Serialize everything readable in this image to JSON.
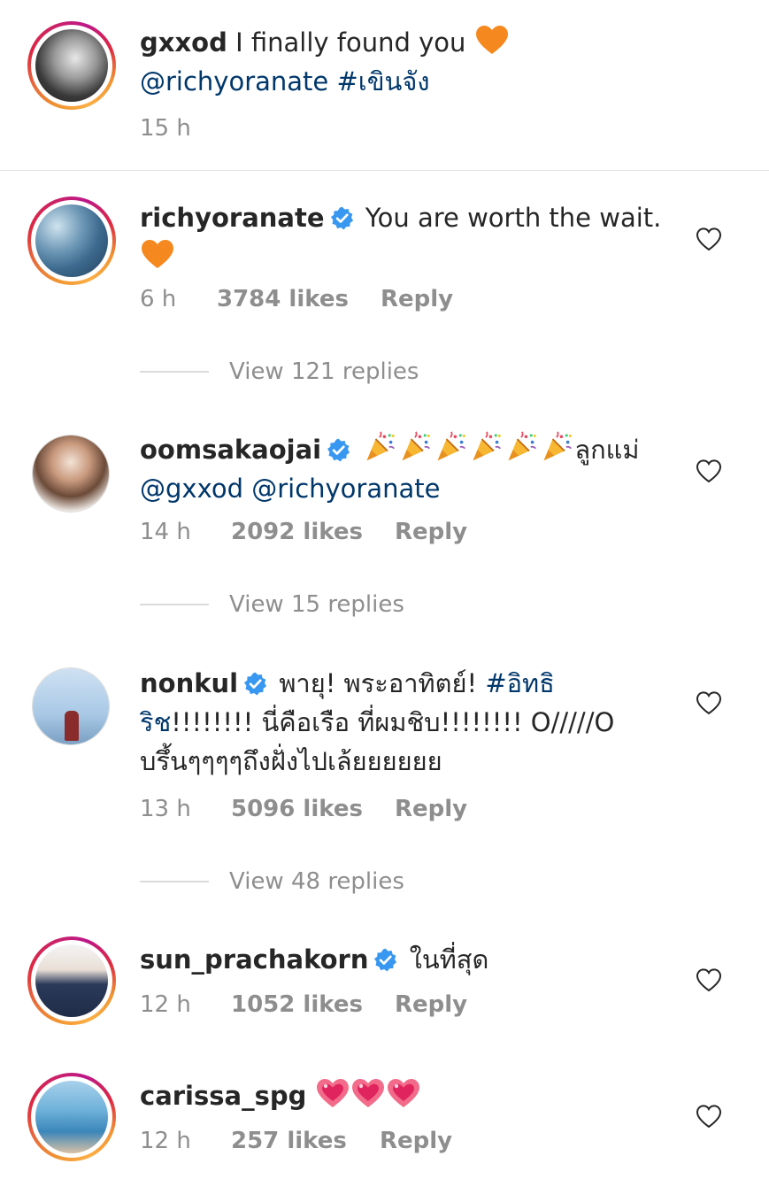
{
  "caption": {
    "username": "gxxod",
    "text": "I finally found you",
    "mention": "@richyoranate",
    "hashtag": "#เขินจัง",
    "time": "15 h"
  },
  "comments": [
    {
      "username": "richyoranate",
      "verified": true,
      "text": "You are worth the wait.",
      "time": "6 h",
      "likes": "3784 likes",
      "reply": "Reply",
      "view_replies": "View 121 replies"
    },
    {
      "username": "oomsakaojai",
      "verified": true,
      "text": "ลูกแม่",
      "mention_1": "@gxxod",
      "mention_2": "@richyoranate",
      "time": "14 h",
      "likes": "2092 likes",
      "reply": "Reply",
      "view_replies": "View 15 replies"
    },
    {
      "username": "nonkul",
      "verified": true,
      "text_1": "พายุ! พระอาทิตย์!",
      "hashtag": "#อิทธิริช",
      "hashtag_part_1": "#อิทธิ",
      "hashtag_part_2": "ริช",
      "text_2": "!!!!!!!! นี่คือเรือ ที่ผมชิบ!!!!!!!! O/////O",
      "text_3": "บรึ้นๆๆๆๆถึงฝั่งไปเล้ยยยยยย",
      "time": "13 h",
      "likes": "5096 likes",
      "reply": "Reply",
      "view_replies": "View 48 replies"
    },
    {
      "username": "sun_prachakorn",
      "verified": true,
      "text": "ในที่สุด",
      "time": "12 h",
      "likes": "1052 likes",
      "reply": "Reply"
    },
    {
      "username": "carissa_spg",
      "verified": false,
      "text": "",
      "time": "12 h",
      "likes": "257 likes",
      "reply": "Reply"
    }
  ],
  "icons": {
    "heart": "heart-outline-icon",
    "verified": "verified-badge-icon",
    "orange_heart": "orange-heart-emoji",
    "party_popper": "party-popper-emoji",
    "sparkling_heart": "sparkling-heart-emoji"
  },
  "colors": {
    "text": "#262626",
    "secondary": "#8e8e8e",
    "link": "#00376b",
    "verified": "#3897f0",
    "orange_heart": "#f5891f",
    "heart_red": "#e0245e"
  }
}
